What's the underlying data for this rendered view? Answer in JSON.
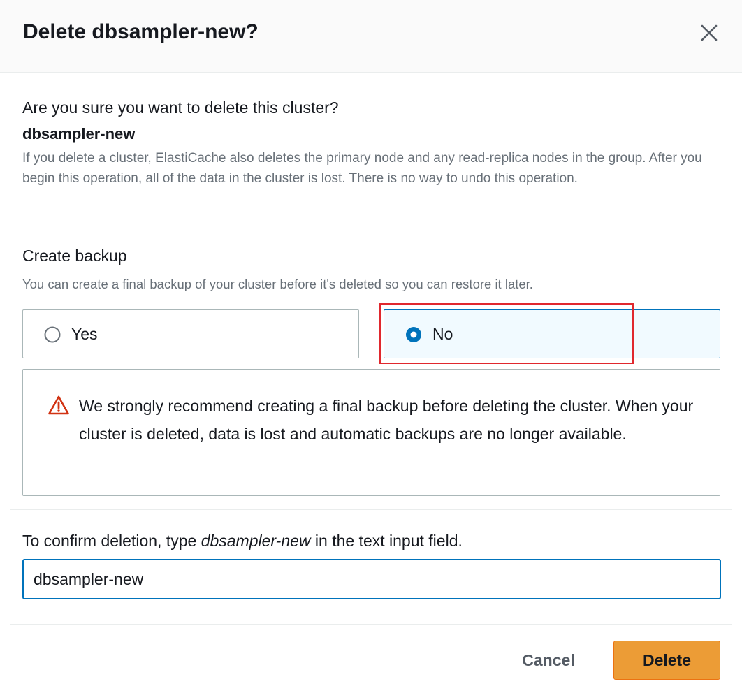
{
  "modal": {
    "title": "Delete dbsampler-new?",
    "close_icon": "close-icon"
  },
  "intro": {
    "question": "Are you sure you want to delete this cluster?",
    "cluster_name": "dbsampler-new",
    "description": "If you delete a cluster, ElastiCache also deletes the primary node and any read-replica nodes in the group. After you begin this operation, all of the data in the cluster is lost. There is no way to undo this operation."
  },
  "backup": {
    "label": "Create backup",
    "description": "You can create a final backup of your cluster before it's deleted so you can restore it later.",
    "options": [
      {
        "label": "Yes",
        "selected": false
      },
      {
        "label": "No",
        "selected": true
      }
    ]
  },
  "alert": {
    "icon": "warning-icon",
    "text": "We strongly recommend creating a final backup before deleting the cluster. When your cluster is deleted, data is lost and automatic backups are no longer available."
  },
  "confirm": {
    "label_prefix": "To confirm deletion, type ",
    "label_name": "dbsampler-new",
    "label_suffix": " in the text input field.",
    "input_value": "dbsampler-new"
  },
  "footer": {
    "cancel_label": "Cancel",
    "delete_label": "Delete"
  },
  "colors": {
    "primary_button": "#ec9c36",
    "selected_tile_bg": "#f1faff",
    "selected_border": "#0073bb",
    "warning": "#d13212",
    "annotation_highlight": "#e0282e"
  }
}
